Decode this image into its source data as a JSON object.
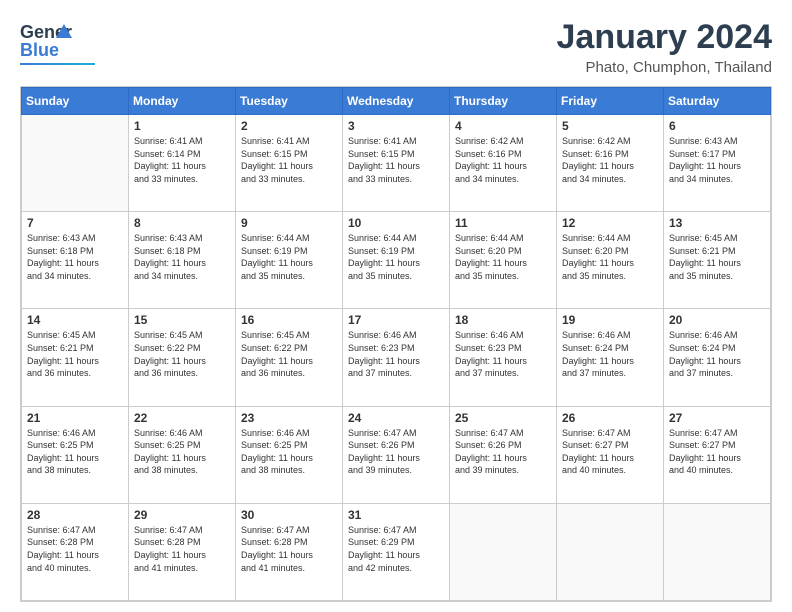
{
  "header": {
    "logo": {
      "line1": "General",
      "line2": "Blue"
    },
    "title": "January 2024",
    "subtitle": "Phato, Chumphon, Thailand"
  },
  "calendar": {
    "days_of_week": [
      "Sunday",
      "Monday",
      "Tuesday",
      "Wednesday",
      "Thursday",
      "Friday",
      "Saturday"
    ],
    "weeks": [
      [
        {
          "day": "",
          "info": ""
        },
        {
          "day": "1",
          "info": "Sunrise: 6:41 AM\nSunset: 6:14 PM\nDaylight: 11 hours\nand 33 minutes."
        },
        {
          "day": "2",
          "info": "Sunrise: 6:41 AM\nSunset: 6:15 PM\nDaylight: 11 hours\nand 33 minutes."
        },
        {
          "day": "3",
          "info": "Sunrise: 6:41 AM\nSunset: 6:15 PM\nDaylight: 11 hours\nand 33 minutes."
        },
        {
          "day": "4",
          "info": "Sunrise: 6:42 AM\nSunset: 6:16 PM\nDaylight: 11 hours\nand 34 minutes."
        },
        {
          "day": "5",
          "info": "Sunrise: 6:42 AM\nSunset: 6:16 PM\nDaylight: 11 hours\nand 34 minutes."
        },
        {
          "day": "6",
          "info": "Sunrise: 6:43 AM\nSunset: 6:17 PM\nDaylight: 11 hours\nand 34 minutes."
        }
      ],
      [
        {
          "day": "7",
          "info": "Sunrise: 6:43 AM\nSunset: 6:18 PM\nDaylight: 11 hours\nand 34 minutes."
        },
        {
          "day": "8",
          "info": "Sunrise: 6:43 AM\nSunset: 6:18 PM\nDaylight: 11 hours\nand 34 minutes."
        },
        {
          "day": "9",
          "info": "Sunrise: 6:44 AM\nSunset: 6:19 PM\nDaylight: 11 hours\nand 35 minutes."
        },
        {
          "day": "10",
          "info": "Sunrise: 6:44 AM\nSunset: 6:19 PM\nDaylight: 11 hours\nand 35 minutes."
        },
        {
          "day": "11",
          "info": "Sunrise: 6:44 AM\nSunset: 6:20 PM\nDaylight: 11 hours\nand 35 minutes."
        },
        {
          "day": "12",
          "info": "Sunrise: 6:44 AM\nSunset: 6:20 PM\nDaylight: 11 hours\nand 35 minutes."
        },
        {
          "day": "13",
          "info": "Sunrise: 6:45 AM\nSunset: 6:21 PM\nDaylight: 11 hours\nand 35 minutes."
        }
      ],
      [
        {
          "day": "14",
          "info": "Sunrise: 6:45 AM\nSunset: 6:21 PM\nDaylight: 11 hours\nand 36 minutes."
        },
        {
          "day": "15",
          "info": "Sunrise: 6:45 AM\nSunset: 6:22 PM\nDaylight: 11 hours\nand 36 minutes."
        },
        {
          "day": "16",
          "info": "Sunrise: 6:45 AM\nSunset: 6:22 PM\nDaylight: 11 hours\nand 36 minutes."
        },
        {
          "day": "17",
          "info": "Sunrise: 6:46 AM\nSunset: 6:23 PM\nDaylight: 11 hours\nand 37 minutes."
        },
        {
          "day": "18",
          "info": "Sunrise: 6:46 AM\nSunset: 6:23 PM\nDaylight: 11 hours\nand 37 minutes."
        },
        {
          "day": "19",
          "info": "Sunrise: 6:46 AM\nSunset: 6:24 PM\nDaylight: 11 hours\nand 37 minutes."
        },
        {
          "day": "20",
          "info": "Sunrise: 6:46 AM\nSunset: 6:24 PM\nDaylight: 11 hours\nand 37 minutes."
        }
      ],
      [
        {
          "day": "21",
          "info": "Sunrise: 6:46 AM\nSunset: 6:25 PM\nDaylight: 11 hours\nand 38 minutes."
        },
        {
          "day": "22",
          "info": "Sunrise: 6:46 AM\nSunset: 6:25 PM\nDaylight: 11 hours\nand 38 minutes."
        },
        {
          "day": "23",
          "info": "Sunrise: 6:46 AM\nSunset: 6:25 PM\nDaylight: 11 hours\nand 38 minutes."
        },
        {
          "day": "24",
          "info": "Sunrise: 6:47 AM\nSunset: 6:26 PM\nDaylight: 11 hours\nand 39 minutes."
        },
        {
          "day": "25",
          "info": "Sunrise: 6:47 AM\nSunset: 6:26 PM\nDaylight: 11 hours\nand 39 minutes."
        },
        {
          "day": "26",
          "info": "Sunrise: 6:47 AM\nSunset: 6:27 PM\nDaylight: 11 hours\nand 40 minutes."
        },
        {
          "day": "27",
          "info": "Sunrise: 6:47 AM\nSunset: 6:27 PM\nDaylight: 11 hours\nand 40 minutes."
        }
      ],
      [
        {
          "day": "28",
          "info": "Sunrise: 6:47 AM\nSunset: 6:28 PM\nDaylight: 11 hours\nand 40 minutes."
        },
        {
          "day": "29",
          "info": "Sunrise: 6:47 AM\nSunset: 6:28 PM\nDaylight: 11 hours\nand 41 minutes."
        },
        {
          "day": "30",
          "info": "Sunrise: 6:47 AM\nSunset: 6:28 PM\nDaylight: 11 hours\nand 41 minutes."
        },
        {
          "day": "31",
          "info": "Sunrise: 6:47 AM\nSunset: 6:29 PM\nDaylight: 11 hours\nand 42 minutes."
        },
        {
          "day": "",
          "info": ""
        },
        {
          "day": "",
          "info": ""
        },
        {
          "day": "",
          "info": ""
        }
      ]
    ]
  }
}
